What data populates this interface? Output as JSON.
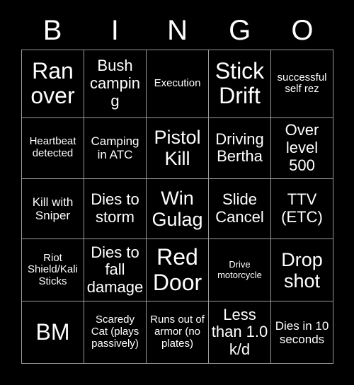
{
  "card": {
    "background_color": "#000000",
    "text_color": "#ffffff",
    "grid_line_color": "#9a9a9a",
    "header_letters": [
      "B",
      "I",
      "N",
      "G",
      "O"
    ],
    "columns": 5,
    "rows": 5,
    "cells": [
      [
        {
          "text": "Ran over",
          "size": "fs-xl"
        },
        {
          "text": "Bush camping",
          "size": "fs-md"
        },
        {
          "text": "Execution",
          "size": "fs-xs"
        },
        {
          "text": "Stick Drift",
          "size": "fs-xl"
        },
        {
          "text": "successful self rez",
          "size": "fs-xs"
        }
      ],
      [
        {
          "text": "Heartbeat detected",
          "size": "fs-xs"
        },
        {
          "text": "Camping in ATC",
          "size": "fs-sm"
        },
        {
          "text": "Pistol Kill",
          "size": "fs-lg"
        },
        {
          "text": "Driving Bertha",
          "size": "fs-md"
        },
        {
          "text": "Over level 500",
          "size": "fs-md"
        }
      ],
      [
        {
          "text": "Kill with Sniper",
          "size": "fs-sm"
        },
        {
          "text": "Dies to storm",
          "size": "fs-md"
        },
        {
          "text": "Win Gulag",
          "size": "fs-lg"
        },
        {
          "text": "Slide Cancel",
          "size": "fs-md"
        },
        {
          "text": "TTV (ETC)",
          "size": "fs-md"
        }
      ],
      [
        {
          "text": "Riot Shield/Kali Sticks",
          "size": "fs-xs"
        },
        {
          "text": "Dies to fall damage",
          "size": "fs-md"
        },
        {
          "text": "Red Door",
          "size": "fs-xl"
        },
        {
          "text": "Drive motorcycle",
          "size": "fs-xxs"
        },
        {
          "text": "Drop shot",
          "size": "fs-lg"
        }
      ],
      [
        {
          "text": "BM",
          "size": "fs-xl"
        },
        {
          "text": "Scaredy Cat (plays passively)",
          "size": "fs-xs"
        },
        {
          "text": "Runs out of armor (no plates)",
          "size": "fs-xs"
        },
        {
          "text": "Less than 1.0 k/d",
          "size": "fs-md"
        },
        {
          "text": "Dies in 10 seconds",
          "size": "fs-sm"
        }
      ]
    ]
  }
}
